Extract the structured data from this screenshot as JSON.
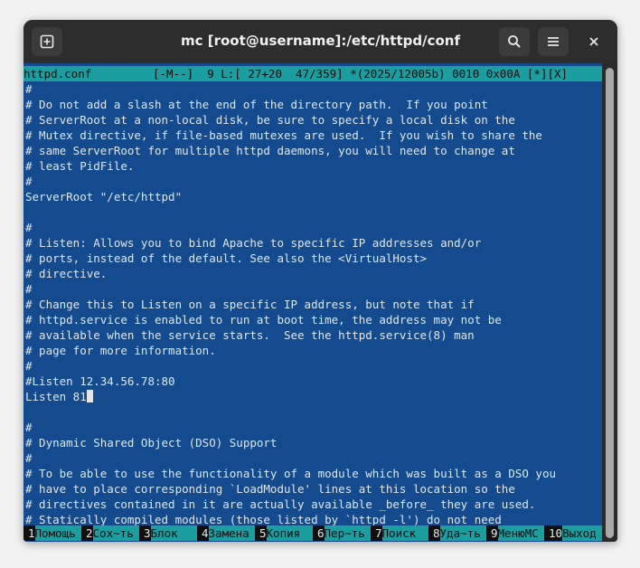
{
  "window": {
    "title": "mc [root@username]:/etc/httpd/conf"
  },
  "editor": {
    "status": "httpd.conf         [-M--]  9 L:[ 27+20  47/359] *(2025/12005b) 0010 0x00A [*][X]",
    "lines": [
      "#",
      "# Do not add a slash at the end of the directory path.  If you point",
      "# ServerRoot at a non-local disk, be sure to specify a local disk on the",
      "# Mutex directive, if file-based mutexes are used.  If you wish to share the",
      "# same ServerRoot for multiple httpd daemons, you will need to change at",
      "# least PidFile.",
      "#",
      "ServerRoot \"/etc/httpd\"",
      "",
      "#",
      "# Listen: Allows you to bind Apache to specific IP addresses and/or",
      "# ports, instead of the default. See also the <VirtualHost>",
      "# directive.",
      "#",
      "# Change this to Listen on a specific IP address, but note that if",
      "# httpd.service is enabled to run at boot time, the address may not be",
      "# available when the service starts.  See the httpd.service(8) man",
      "# page for more information.",
      "#",
      "#Listen 12.34.56.78:80",
      "Listen 81",
      "",
      "#",
      "# Dynamic Shared Object (DSO) Support",
      "#",
      "# To be able to use the functionality of a module which was built as a DSO you",
      "# have to place corresponding `LoadModule' lines at this location so the",
      "# directives contained in it are actually available _before_ they are used.",
      "# Statically compiled modules (those listed by `httpd -l') do not need"
    ]
  },
  "fkeys": [
    {
      "num": "1",
      "label": "Помощь"
    },
    {
      "num": "2",
      "label": "Сох~ть"
    },
    {
      "num": "3",
      "label": "Блок"
    },
    {
      "num": "4",
      "label": "Замена"
    },
    {
      "num": "5",
      "label": "Копия"
    },
    {
      "num": "6",
      "label": "Пер~ть"
    },
    {
      "num": "7",
      "label": "Поиск"
    },
    {
      "num": "8",
      "label": "Уда~ть"
    },
    {
      "num": "9",
      "label": "МенюMC"
    },
    {
      "num": "10",
      "label": "Выход"
    }
  ]
}
